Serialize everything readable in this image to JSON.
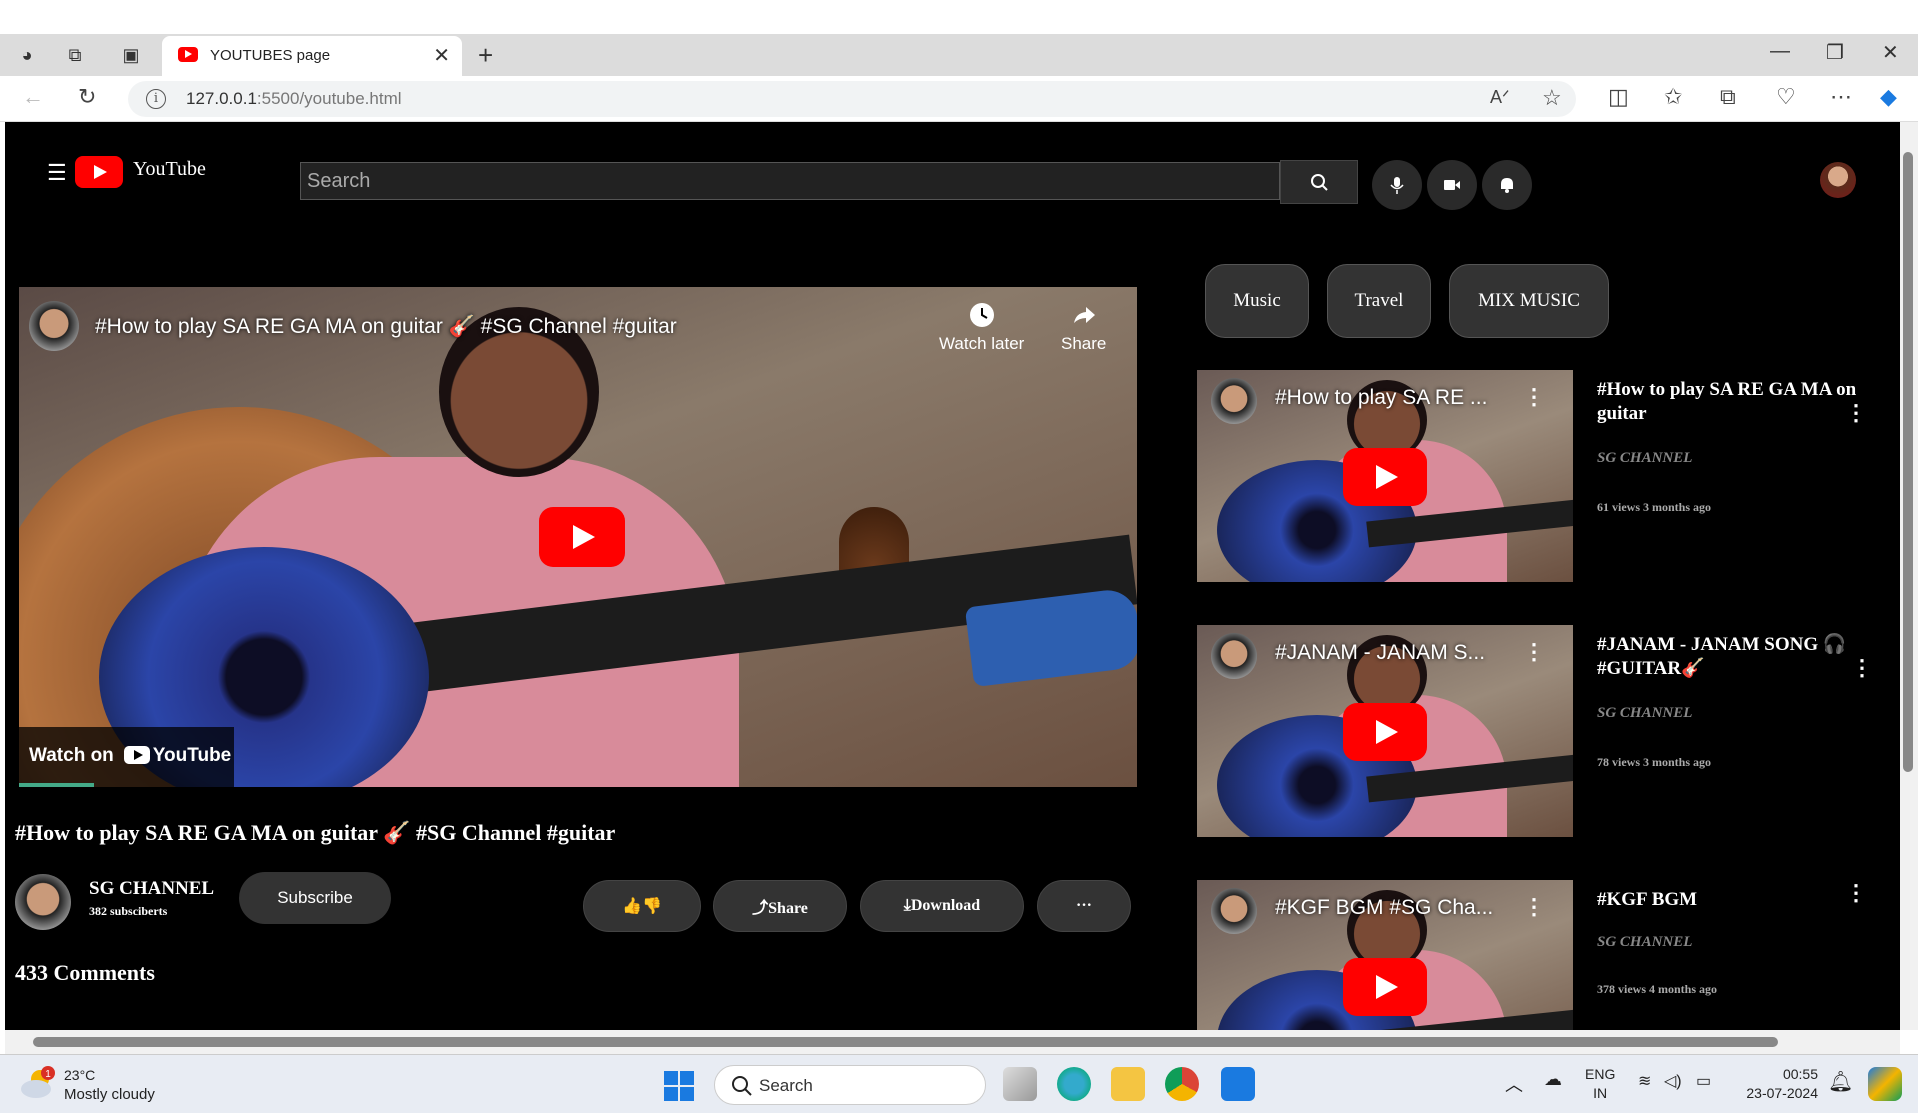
{
  "browser": {
    "tab_title": "YOUTUBES page",
    "url_host": "127.0.0.1",
    "url_rest": ":5500/youtube.html"
  },
  "header": {
    "logo_text": "YouTube",
    "search_placeholder": "Search"
  },
  "player": {
    "overlay_title": "#How to play SA RE GA MA on guitar 🎸 #SG Channel #guitar",
    "watch_later": "Watch later",
    "share": "Share",
    "watch_on": "Watch on",
    "watch_on_brand": "YouTube"
  },
  "video": {
    "title": "#How to play SA RE GA MA on guitar 🎸 #SG Channel #guitar",
    "channel": "SG CHANNEL",
    "subscribers": "382 subsciberts",
    "subscribe_label": "Subscribe",
    "like_label": "👍👎",
    "share_label": "⤴Share",
    "download_label": "⤓Download",
    "more_label": "···",
    "comments": "433 Comments"
  },
  "chips": [
    "Music",
    "Travel",
    "MIX MUSIC"
  ],
  "recommendations": [
    {
      "thumb_title": "#How to play SA RE ...",
      "title": "#How to play SA RE GA MA on guitar",
      "channel": "SG CHANNEL",
      "meta": "61 views 3 months ago"
    },
    {
      "thumb_title": "#JANAM - JANAM S...",
      "title": "#JANAM - JANAM SONG 🎧 #GUITAR🎸",
      "channel": "SG CHANNEL",
      "meta": "78 views 3 months ago"
    },
    {
      "thumb_title": "#KGF BGM #SG Cha...",
      "title": "#KGF BGM",
      "channel": "SG CHANNEL",
      "meta": "378 views 4 months ago"
    }
  ],
  "taskbar": {
    "temp": "23°C",
    "weather": "Mostly cloudy",
    "weather_badge": "1",
    "search_label": "Search",
    "lang1": "ENG",
    "lang2": "IN",
    "time": "00:55",
    "date": "23-07-2024"
  }
}
